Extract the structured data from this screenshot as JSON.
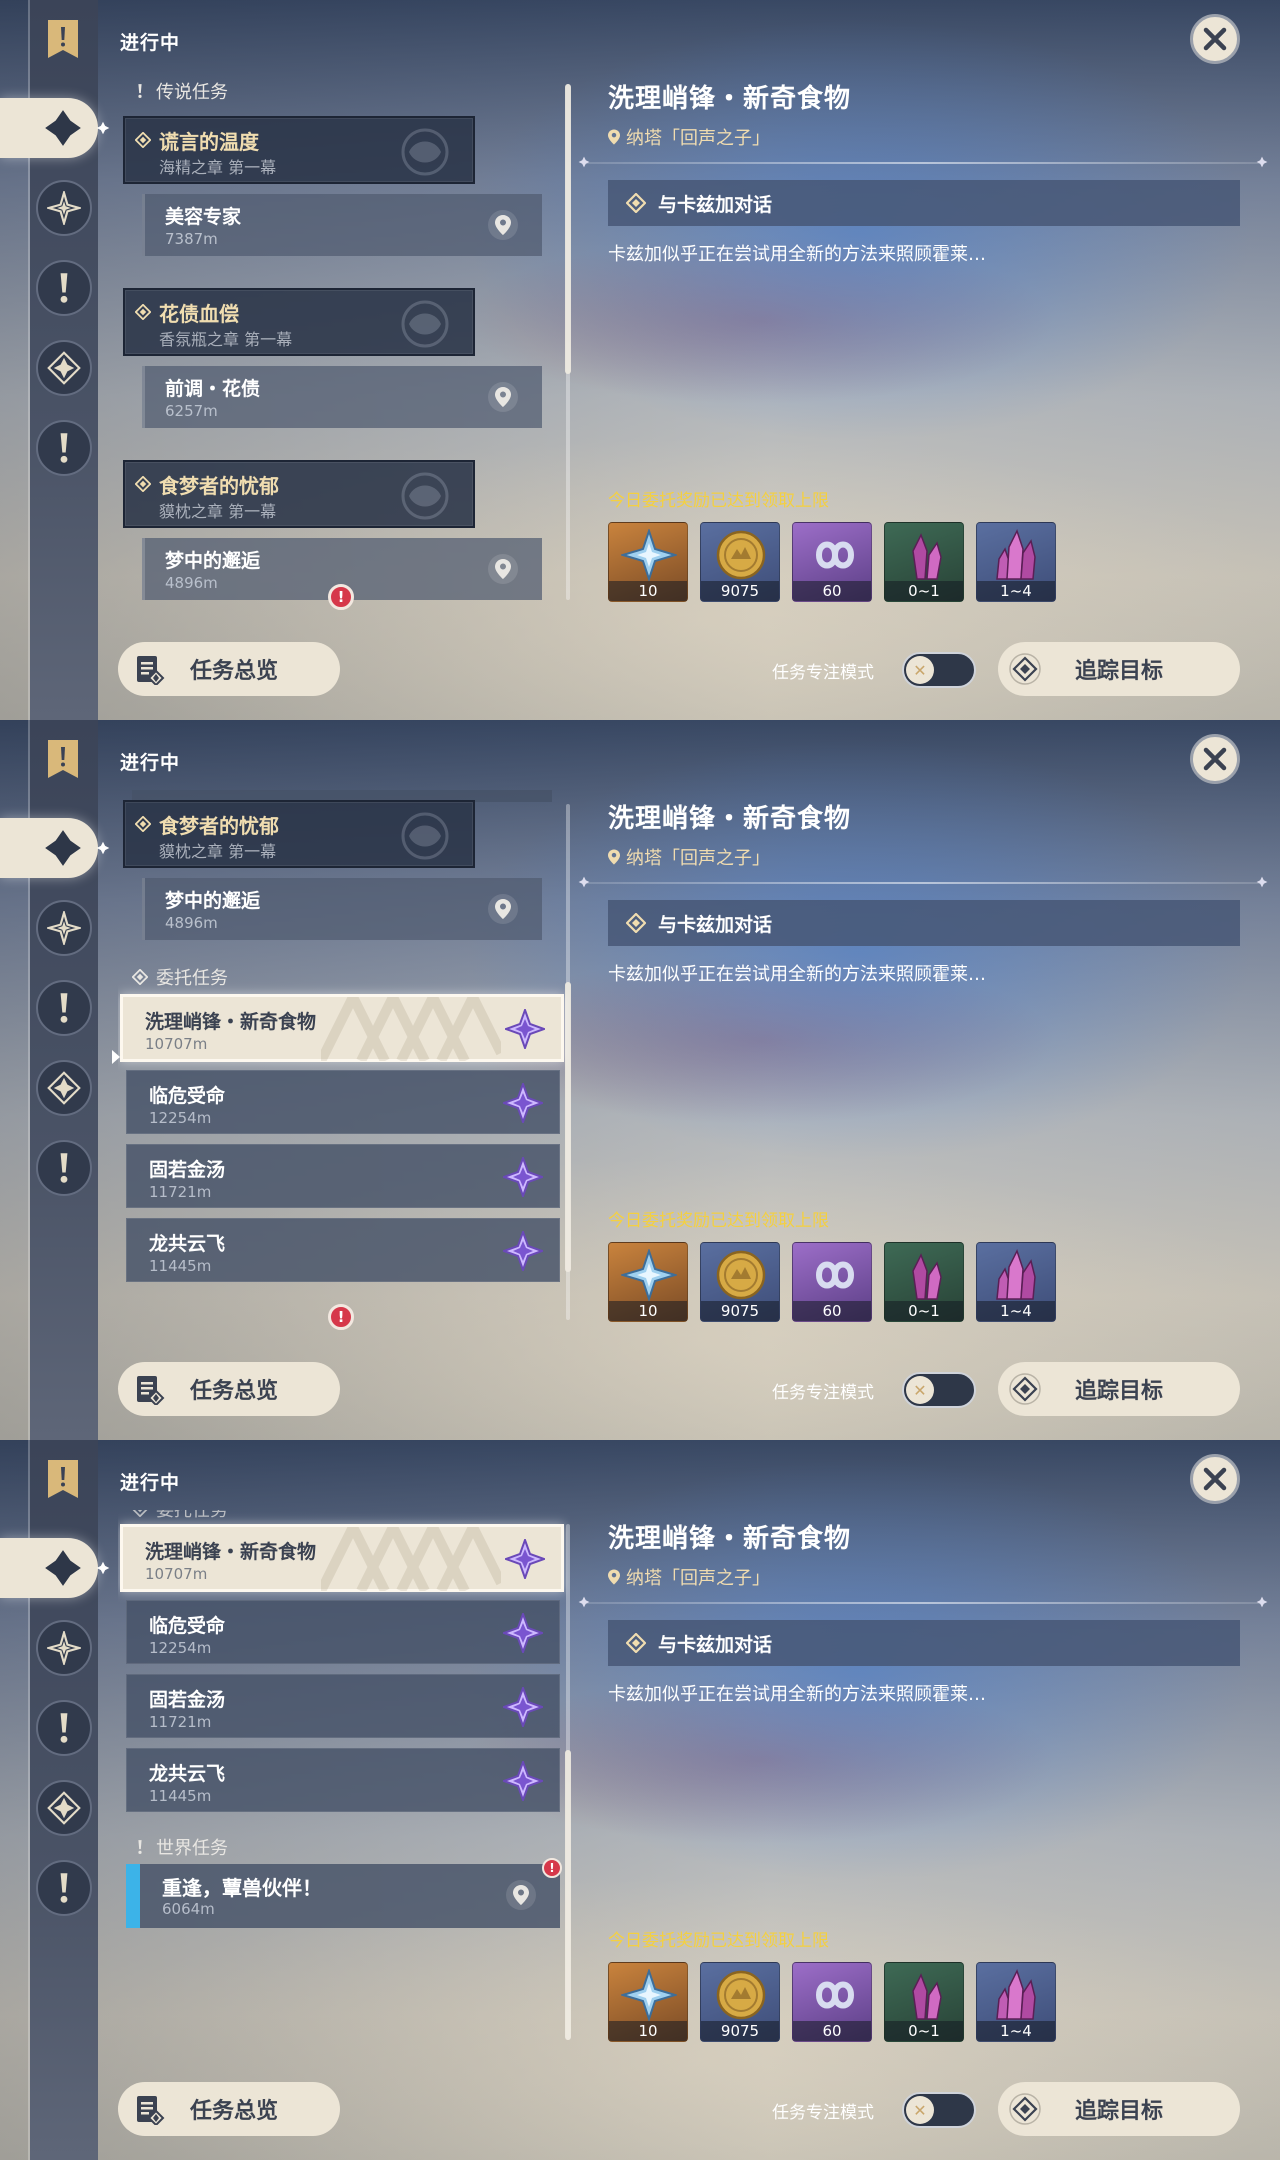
{
  "header": {
    "section_title": "进行中",
    "overview_label": "任务总览",
    "focus_mode_label": "任务专注模式",
    "focus_toggle_state": "off",
    "track_label": "追踪目标"
  },
  "categories": {
    "legend": "传说任务",
    "commission": "委托任务",
    "world": "世界任务"
  },
  "legend_quests": [
    {
      "title": "谎言的温度",
      "chapter": "海精之章 第一幕",
      "sub_title": "美容专家",
      "sub_distance": "7387m"
    },
    {
      "title": "花债血偿",
      "chapter": "香氛瓶之章 第一幕",
      "sub_title": "前调・花债",
      "sub_distance": "6257m"
    },
    {
      "title": "食梦者的忧郁",
      "chapter": "貘枕之章 第一幕",
      "sub_title": "梦中的邂逅",
      "sub_distance": "4896m"
    }
  ],
  "commissions": [
    {
      "title": "洗理峭锋・新奇食物",
      "distance": "10707m"
    },
    {
      "title": "临危受命",
      "distance": "12254m"
    },
    {
      "title": "固若金汤",
      "distance": "11721m"
    },
    {
      "title": "龙共云飞",
      "distance": "11445m"
    }
  ],
  "world_quests": [
    {
      "title": "重逢，蕈兽伙伴！",
      "distance": "6064m"
    }
  ],
  "alert_glyph": "!",
  "detail": {
    "title": "洗理峭锋・新奇食物",
    "location": "纳塔「回声之子」",
    "objective": "与卡兹加对话",
    "description": "卡兹加似乎正在尝试用全新的方法来照顾霍莱…",
    "reward_note": "今日委托奖励已达到领取上限",
    "rewards": [
      {
        "icon": "intertwined-fate-icon",
        "count": "10"
      },
      {
        "icon": "mora-icon",
        "count": "9075"
      },
      {
        "icon": "companionship-exp-icon",
        "count": "60"
      },
      {
        "icon": "crystal-small-icon",
        "count": "0~1"
      },
      {
        "icon": "crystal-large-icon",
        "count": "1~4"
      }
    ]
  },
  "colors": {
    "accent_gold": "#f0ddb0",
    "reward_note": "#f4d040",
    "world_quest_bar": "#3cb3e8",
    "alert_red": "#d6384a"
  }
}
